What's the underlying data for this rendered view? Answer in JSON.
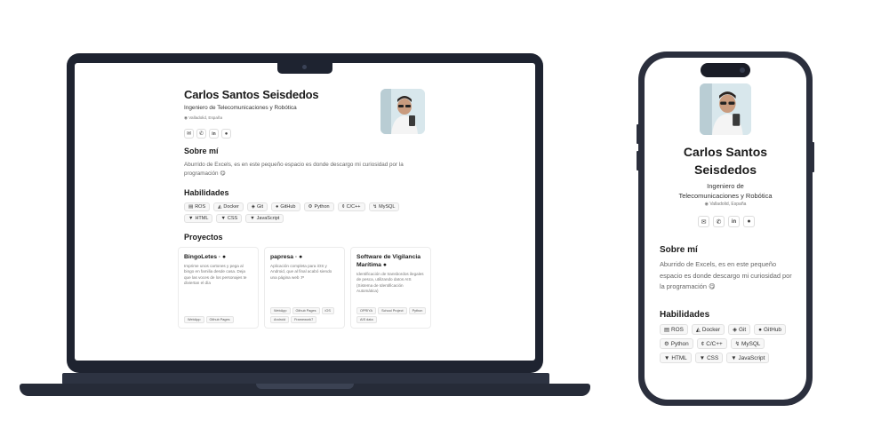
{
  "profile": {
    "name": "Carlos Santos Seisdedos",
    "name_line1": "Carlos Santos",
    "name_line2": "Seisdedos",
    "role": "Ingeniero de Telecomunicaciones y Robótica",
    "role_line1": "Ingeniero de",
    "role_line2": "Telecomunicaciones y Robótica",
    "location": "Valladolid, España",
    "contact_icons": [
      "mail-icon",
      "phone-icon",
      "linkedin-icon",
      "github-icon"
    ]
  },
  "about": {
    "heading": "Sobre mí",
    "text": "Aburrido de Excels, es en este pequeño espacio es donde descargo mi curiosidad por la programación 😋"
  },
  "skills": {
    "heading": "Habilidades",
    "items": [
      {
        "label": "ROS",
        "icon": "▤"
      },
      {
        "label": "Docker",
        "icon": "◭"
      },
      {
        "label": "Git",
        "icon": "◈"
      },
      {
        "label": "GitHub",
        "icon": "●"
      },
      {
        "label": "Python",
        "icon": "⚙"
      },
      {
        "label": "C/C++",
        "icon": "¢"
      },
      {
        "label": "MySQL",
        "icon": "↯"
      },
      {
        "label": "HTML",
        "icon": "▼"
      },
      {
        "label": "CSS",
        "icon": "▼"
      },
      {
        "label": "JavaScript",
        "icon": "▼"
      }
    ]
  },
  "projects": {
    "heading": "Proyectos",
    "items": [
      {
        "title": "BingoLetes ·",
        "description": "Imprime unos cartones y pega al bingo en familia desde casa. Deja que las voces de los personajes te diviertan el día",
        "tags": [
          "WebApp",
          "Github Pages"
        ]
      },
      {
        "title": "papresa ·",
        "description": "Aplicación completa para iOS y Android, que al final acabó siendo una página web :P",
        "tags": [
          "WebApp",
          "Github Pages",
          "iOS",
          "Android",
          "Framework7"
        ]
      },
      {
        "title": "Software de Vigilancia Marítima",
        "description": "Identificación de transbordos ilegales de pesca, utilizando datos AIS (Sistema de Identificación Automática)",
        "tags": [
          "OPRIYA",
          "School Project",
          "Python",
          "AIS data"
        ]
      }
    ]
  }
}
